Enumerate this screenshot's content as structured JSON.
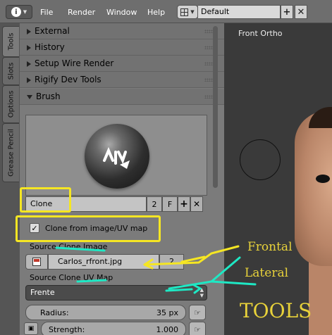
{
  "header": {
    "menus": [
      "File",
      "Render",
      "Window",
      "Help"
    ],
    "layout_name": "Default",
    "add_icon": "plus-icon",
    "close_icon": "x-icon"
  },
  "tabs": [
    "Tools",
    "Slots",
    "Options",
    "Grease Pencil"
  ],
  "panels": [
    "External",
    "History",
    "Setup Wire Render",
    "Rigify Dev Tools",
    "Brush"
  ],
  "brush": {
    "name": "Clone",
    "users": "2",
    "fake_user": "F",
    "clone_from_uv": "Clone from image/UV map",
    "clone_from_uv_checked": true,
    "source_image_label": "Source Clone Image",
    "source_image": "Carlos_rfront.jpg",
    "source_image_users": "2",
    "source_uv_label": "Source Clone UV Map",
    "source_uv": "Frente",
    "radius_label": "Radius:",
    "radius_value": "35 px",
    "strength_label": "Strength:",
    "strength_value": "1.000"
  },
  "viewport": {
    "title": "Front Ortho"
  },
  "annotations": {
    "frontal": "Frontal",
    "lateral": "Lateral",
    "tools": "TOOLS",
    "colors": {
      "yellow": "#f5e623",
      "cyan": "#1ee8c4"
    }
  }
}
